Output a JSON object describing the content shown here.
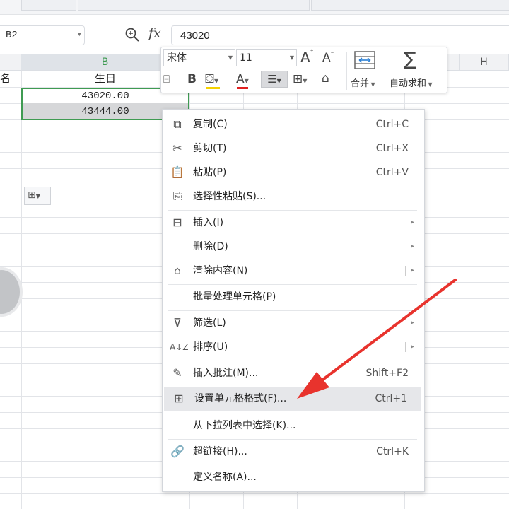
{
  "formula_bar": {
    "cell_ref": "B2",
    "fx_label": "fx",
    "value": "43020"
  },
  "sheet": {
    "columns": [
      "B",
      "H"
    ],
    "header_row": {
      "a_partial": "名",
      "b": "生日"
    },
    "rows": [
      {
        "b": "43020.00"
      },
      {
        "b": "43444.00"
      }
    ]
  },
  "mini_toolbar": {
    "font_name": "宋体",
    "font_size": "11",
    "merge_label": "合并",
    "autosum_label": "自动求和"
  },
  "context_menu": {
    "items": [
      {
        "icon": "copy-icon",
        "label": "复制(C)",
        "shortcut": "Ctrl+C"
      },
      {
        "icon": "cut-icon",
        "label": "剪切(T)",
        "shortcut": "Ctrl+X"
      },
      {
        "icon": "paste-icon",
        "label": "粘贴(P)",
        "shortcut": "Ctrl+V"
      },
      {
        "icon": "paste-special-icon",
        "label": "选择性粘贴(S)..."
      },
      {
        "icon": "insert-icon",
        "label": "插入(I)"
      },
      {
        "label": "删除(D)"
      },
      {
        "icon": "eraser-icon",
        "label": "清除内容(N)"
      },
      {
        "label": "批量处理单元格(P)"
      },
      {
        "icon": "filter-icon",
        "label": "筛选(L)"
      },
      {
        "icon": "sort-icon",
        "label": "排序(U)"
      },
      {
        "icon": "comment-icon",
        "label": "插入批注(M)...",
        "shortcut": "Shift+F2"
      },
      {
        "icon": "format-cells-icon",
        "label": "设置单元格格式(F)...",
        "shortcut": "Ctrl+1",
        "highlighted": true
      },
      {
        "label": "从下拉列表中选择(K)..."
      },
      {
        "icon": "link-icon",
        "label": "超链接(H)...",
        "shortcut": "Ctrl+K"
      },
      {
        "label": "定义名称(A)..."
      }
    ]
  },
  "annotation": {
    "arrow_color": "#e8332d"
  }
}
